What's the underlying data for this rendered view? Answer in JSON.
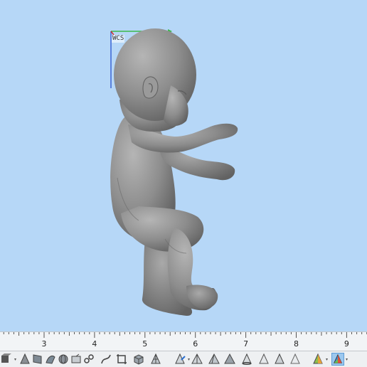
{
  "viewport": {
    "background": "#b6d7f7",
    "coordinate_system_label": "WCS",
    "model": "baby-figure-3d-model",
    "model_color": "#8e8e8e"
  },
  "ruler": {
    "labels": [
      "3",
      "4",
      "5",
      "6",
      "7",
      "8",
      "9"
    ]
  },
  "toolbar": {
    "tools": [
      {
        "name": "solid-view-icon",
        "dropdown": true
      },
      {
        "name": "surface-icon",
        "dropdown": false
      },
      {
        "name": "face-icon",
        "dropdown": false
      },
      {
        "name": "sculpt-icon",
        "dropdown": false
      },
      {
        "name": "sphere-icon",
        "dropdown": false
      },
      {
        "name": "plane-icon",
        "dropdown": false
      },
      {
        "name": "link-icon",
        "dropdown": false
      },
      {
        "name": "curve-icon",
        "dropdown": false
      },
      {
        "name": "crop-icon",
        "dropdown": false
      },
      {
        "name": "cube-icon",
        "dropdown": false
      },
      {
        "name": "mesh-icon",
        "dropdown": false
      },
      {
        "name": "pyramid-edit-icon",
        "dropdown": true
      },
      {
        "name": "pyramid-icon",
        "dropdown": false
      },
      {
        "name": "pyramid-split-icon",
        "dropdown": false
      },
      {
        "name": "pyramid-solid-icon",
        "dropdown": false
      },
      {
        "name": "cone-icon",
        "dropdown": false
      },
      {
        "name": "cone-light-icon",
        "dropdown": false
      },
      {
        "name": "triangle-icon",
        "dropdown": false
      },
      {
        "name": "triangle-outline-icon",
        "dropdown": false
      },
      {
        "name": "shaded-color-icon",
        "dropdown": true
      },
      {
        "name": "color-shaded-active-icon",
        "dropdown": true,
        "active": true
      }
    ]
  }
}
